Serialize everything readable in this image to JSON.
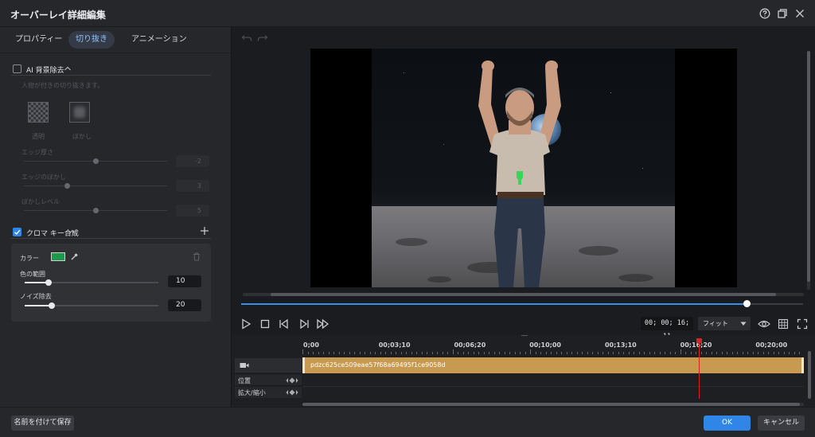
{
  "window": {
    "title": "オーバーレイ詳細編集"
  },
  "tabs": [
    {
      "label": "プロパティー"
    },
    {
      "label": "切り抜き"
    },
    {
      "label": "アニメーション"
    }
  ],
  "ai_bg": {
    "label": "AI 背景除去",
    "checked": false,
    "hint": "人物が付きの切り抜きます。",
    "options": [
      {
        "label": "透明"
      },
      {
        "label": "ぼかし"
      }
    ],
    "sliders": [
      {
        "label": "エッジ厚さ",
        "value": "-2",
        "level": 0.5
      },
      {
        "label": "エッジのぼかし",
        "value": "3",
        "level": 0.3
      },
      {
        "label": "ぼかしレベル",
        "value": "5",
        "level": 0.5
      }
    ]
  },
  "chroma": {
    "label": "クロマ キー合成",
    "checked": true,
    "color_label": "カラー",
    "key_color": "#1f9a4a",
    "color_range": {
      "label": "色の範囲",
      "value": "10",
      "level": 0.18
    },
    "noise": {
      "label": "ノイズ除去",
      "value": "20",
      "level": 0.2
    }
  },
  "preview": {
    "progress": 0.9
  },
  "controls": {
    "timecode": "00; 00; 16; 11",
    "zoom": "フィット"
  },
  "timeline": {
    "ruler": [
      "0;00",
      "00;03;10",
      "00;06;20",
      "00;10;00",
      "00;13;10",
      "00;16;20",
      "00;20;00"
    ],
    "clip_name": "pdzc625ce509eae57f68a69495f1ce9058d",
    "tracks": [
      {
        "label": "位置"
      },
      {
        "label": "拡大/縮小"
      }
    ],
    "playhead": 0.79
  },
  "footer": {
    "save_as": "名前を付けて保存",
    "ok": "OK",
    "cancel": "キャンセル"
  }
}
